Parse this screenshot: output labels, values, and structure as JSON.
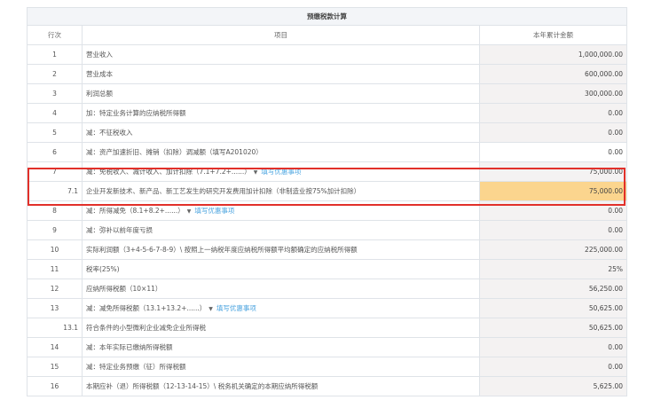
{
  "title": "预缴税款计算",
  "headers": {
    "no": "行次",
    "item": "项目",
    "amount": "本年累计金额"
  },
  "rows": [
    {
      "no": "1",
      "item": "营业收入",
      "amount": "1,000,000.00"
    },
    {
      "no": "2",
      "item": "营业成本",
      "amount": "600,000.00"
    },
    {
      "no": "3",
      "item": "利润总额",
      "amount": "300,000.00"
    },
    {
      "no": "4",
      "item": "加：特定业务计算的应纳税所得额",
      "amount": "0.00"
    },
    {
      "no": "5",
      "item": "减：不征税收入",
      "amount": "0.00"
    },
    {
      "no": "6",
      "item": "减：资产加速折旧、摊销（扣除）调减额（填写A201020）",
      "amount": "0.00"
    },
    {
      "no": "7",
      "item": "减：免税收入、减计收入、加计扣除（7.1+7.2+......）",
      "link": "填写优惠事项",
      "amount": "75,000.00"
    },
    {
      "no": "7.1",
      "item": "企业开发新技术、新产品、新工艺发生的研究开发费用加计扣除（非制造业按75%加计扣除）",
      "amount": "75,000.00"
    },
    {
      "no": "8",
      "item": "减：所得减免（8.1+8.2+......）",
      "link": "填写优惠事项",
      "amount": "0.00"
    },
    {
      "no": "9",
      "item": "减：弥补以前年度亏损",
      "amount": "0.00"
    },
    {
      "no": "10",
      "item": "实际利润额（3+4-5-6-7-8-9）\\ 按照上一纳税年度应纳税所得额平均额确定的应纳税所得额",
      "amount": "225,000.00"
    },
    {
      "no": "11",
      "item": "税率(25%)",
      "amount": "25%"
    },
    {
      "no": "12",
      "item": "应纳所得税额（10×11）",
      "amount": "56,250.00"
    },
    {
      "no": "13",
      "item": "减：减免所得税额（13.1+13.2+......）",
      "link": "填写优惠事项",
      "amount": "50,625.00"
    },
    {
      "no": "13.1",
      "item": "符合条件的小型微利企业减免企业所得税",
      "amount": "50,625.00"
    },
    {
      "no": "14",
      "item": "减：本年实际已缴纳所得税额",
      "amount": "0.00"
    },
    {
      "no": "15",
      "item": "减：特定业务预缴（征）所得税额",
      "amount": "0.00"
    },
    {
      "no": "16",
      "item": "本期应补（退）所得税额（12-13-14-15）\\ 税务机关确定的本期应纳所得税额",
      "amount": "5,625.00"
    }
  ],
  "dropdown_icon": "caret-down-icon",
  "colors": {
    "highlight": "#fbd58e",
    "red_box": "#e1302a",
    "link": "#4aa3df",
    "amount_bg": "#f4f2f2"
  }
}
